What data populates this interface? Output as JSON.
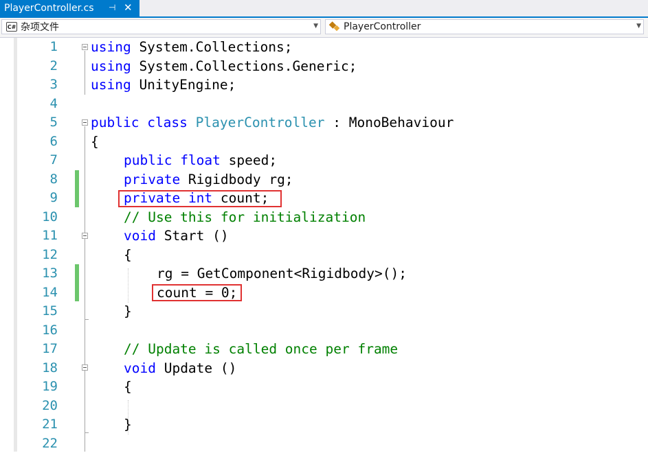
{
  "tab": {
    "title": "PlayerController.cs",
    "pin": "⊣",
    "close": "✕"
  },
  "nav": {
    "project": "杂项文件",
    "cs_badge": "C#",
    "class_name": "PlayerController"
  },
  "line_numbers": [
    "1",
    "2",
    "3",
    "4",
    "5",
    "6",
    "7",
    "8",
    "9",
    "10",
    "11",
    "12",
    "13",
    "14",
    "15",
    "16",
    "17",
    "18",
    "19",
    "20",
    "21",
    "22"
  ],
  "code": {
    "l1": {
      "kw": "using",
      "rest": " System.Collections;"
    },
    "l2": {
      "kw": "using",
      "rest": " System.Collections.Generic;"
    },
    "l3": {
      "kw": "using",
      "rest": " UnityEngine;"
    },
    "l5": {
      "kw1": "public",
      "kw2": "class",
      "type": "PlayerController",
      "rest": " : MonoBehaviour"
    },
    "l6": "{",
    "l7": {
      "kw1": "public",
      "kw2": "float",
      "rest": " speed;"
    },
    "l8": {
      "kw": "private",
      "rest": " Rigidbody rg;"
    },
    "l9": {
      "kw1": "private",
      "kw2": "int",
      "rest": " count;"
    },
    "l10": "// Use this for initialization",
    "l11": {
      "kw": "void",
      "rest": " Start ()"
    },
    "l12": "{",
    "l13": "rg = GetComponent<Rigidbody>();",
    "l14": "count = 0;",
    "l15": "}",
    "l17": "// Update is called once per frame",
    "l18": {
      "kw": "void",
      "rest": " Update ()"
    },
    "l19": "{",
    "l21": "}"
  },
  "colors": {
    "keyword": "#0000ff",
    "type": "#2b91af",
    "comment": "#008000",
    "line_number": "#2b91af",
    "change_marker": "#6cc66c",
    "highlight_box": "#e03131",
    "tab_active": "#007acc"
  }
}
